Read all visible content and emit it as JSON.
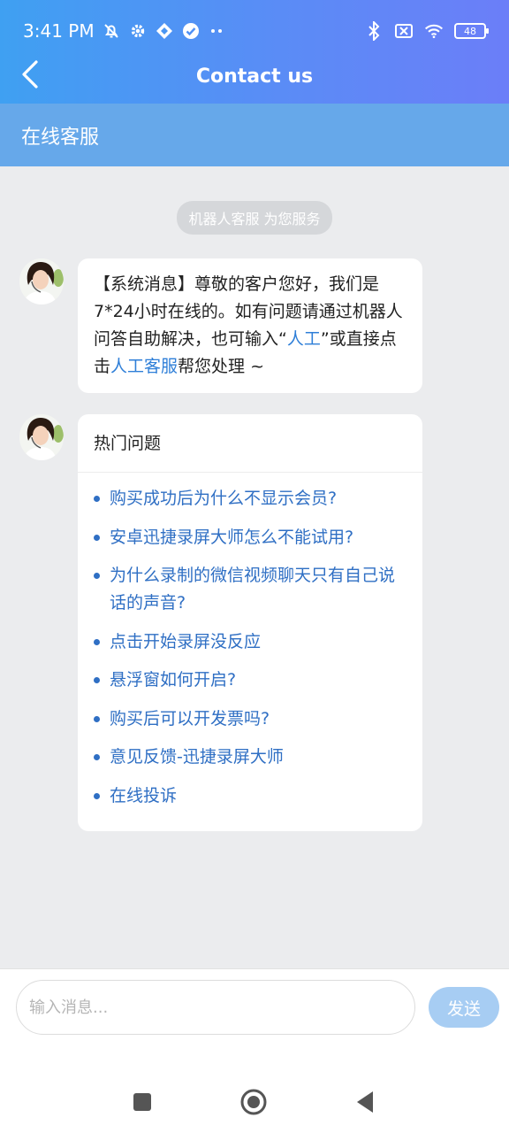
{
  "status_bar": {
    "time": "3:41 PM",
    "battery": "48",
    "icons": [
      "mute-bell-icon",
      "gear-icon",
      "app-icon",
      "check-circle-icon",
      "more-dots-icon",
      "bluetooth-icon",
      "no-sim-icon",
      "wifi-icon",
      "battery-icon"
    ]
  },
  "nav": {
    "title": "Contact us",
    "back_icon": "chevron-left-icon"
  },
  "subheader": {
    "title": "在线客服"
  },
  "system_pill": "机器人客服 为您服务",
  "message1": {
    "part1": "【系统消息】尊敬的客户您好，我们是7*24小时在线的。如有问题请通过机器人问答自助解决，也可输入“",
    "link1": "人工",
    "part2": "”或直接点击",
    "link2": "人工客服",
    "part3": "帮您处理 ~"
  },
  "hot": {
    "title": "热门问题",
    "questions": [
      "购买成功后为什么不显示会员?",
      "安卓迅捷录屏大师怎么不能试用?",
      "为什么录制的微信视频聊天只有自己说话的声音?",
      "点击开始录屏没反应",
      "悬浮窗如何开启?",
      "购买后可以开发票吗?",
      "意见反馈-迅捷录屏大师",
      "在线投诉"
    ]
  },
  "input": {
    "placeholder": "输入消息...",
    "value": "",
    "send_label": "发送"
  },
  "colors": {
    "header_start": "#3fa0f2",
    "header_end": "#6b7ef8",
    "subheader": "#66a8ea",
    "link": "#2f7fd8",
    "send_button": "#a7cdf3"
  }
}
